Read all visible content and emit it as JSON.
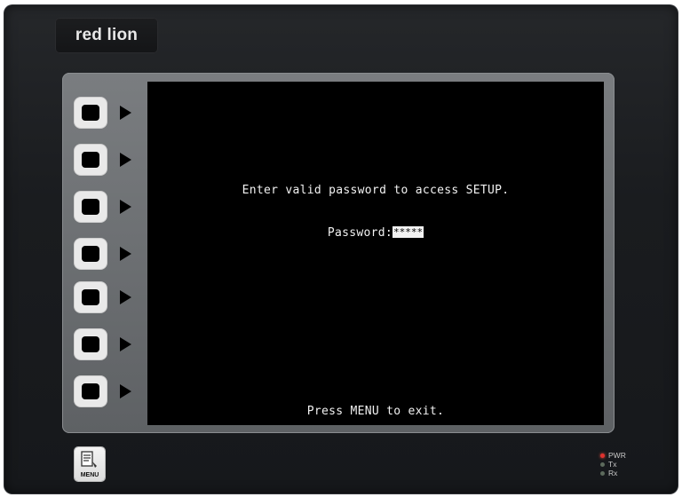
{
  "brand": {
    "logo_text": "red lion"
  },
  "screen": {
    "prompt": "Enter valid password to access SETUP.",
    "password_label": "Password:",
    "password_value": "*****",
    "exit_message": "Press MENU to exit."
  },
  "soft_keys": [
    {
      "id": 1
    },
    {
      "id": 2
    },
    {
      "id": 3
    },
    {
      "id": 4
    },
    {
      "id": 5
    },
    {
      "id": 6
    },
    {
      "id": 7
    }
  ],
  "menu_button": {
    "label": "MENU"
  },
  "status_leds": [
    {
      "label": "PWR",
      "color": "#e0322f"
    },
    {
      "label": "Tx",
      "color": "#5c6a5c"
    },
    {
      "label": "Rx",
      "color": "#5c6a5c"
    }
  ],
  "colors": {
    "screen_bg": "#000000",
    "screen_text": "#f2f2f2",
    "bezel": "#6b6e71",
    "housing": "#1d1f22"
  }
}
